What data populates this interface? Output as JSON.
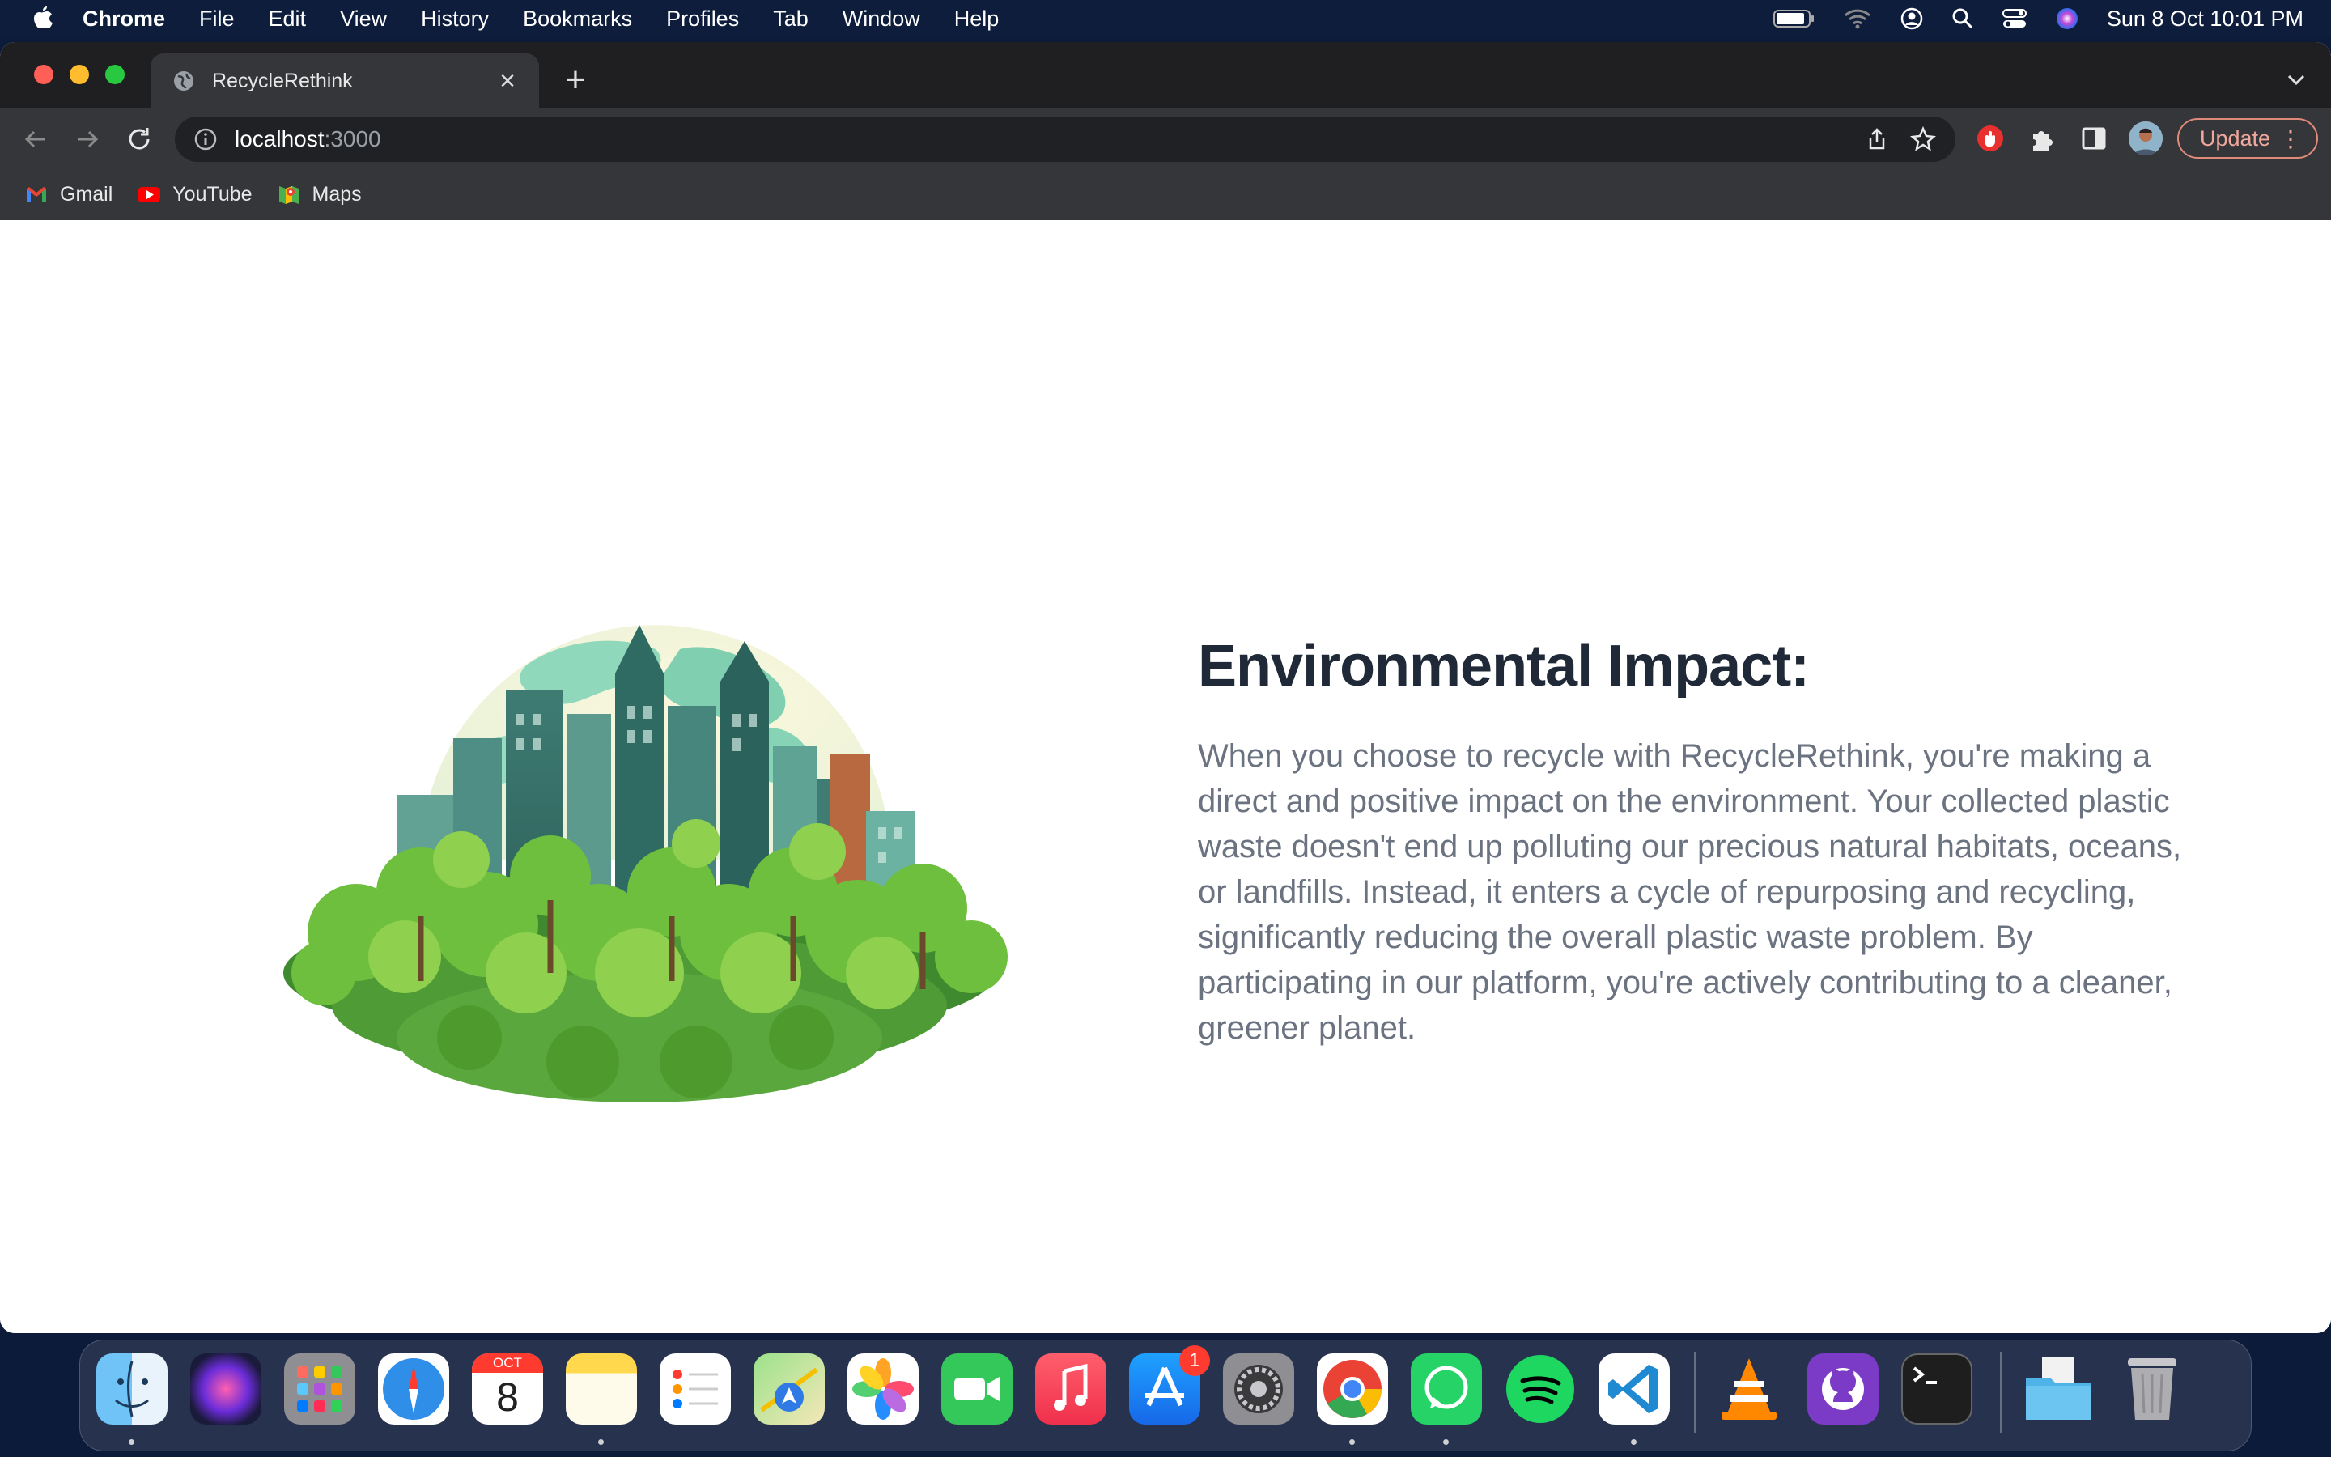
{
  "menubar": {
    "app": "Chrome",
    "items": [
      "File",
      "Edit",
      "View",
      "History",
      "Bookmarks",
      "Profiles",
      "Tab",
      "Window",
      "Help"
    ],
    "datetime": "Sun 8 Oct  10:01 PM"
  },
  "browser": {
    "tab_title": "RecycleRethink",
    "url_host": "localhost",
    "url_port": ":3000",
    "update_label": "Update",
    "bookmarks": [
      "Gmail",
      "YouTube",
      "Maps"
    ]
  },
  "page": {
    "heading": "Environmental Impact:",
    "paragraph": "When you choose to recycle with RecycleRethink, you're making a direct and positive impact on the environment. Your collected plastic waste doesn't end up polluting our precious natural habitats, oceans, or landfills. Instead, it enters a cycle of repurposing and recycling, significantly reducing the overall plastic waste problem. By participating in our platform, you're actively contributing to a cleaner, greener planet."
  },
  "dock": {
    "calendar_month": "OCT",
    "calendar_day": "8",
    "appstore_badge": "1",
    "apps": [
      "Finder",
      "Siri",
      "Launchpad",
      "Safari",
      "Calendar",
      "Notes",
      "Reminders",
      "Maps",
      "Photos",
      "FaceTime",
      "Music",
      "App Store",
      "System Settings",
      "Chrome",
      "WhatsApp",
      "Spotify",
      "VS Code",
      "VLC",
      "GitHub Desktop",
      "Terminal",
      "Downloads",
      "Trash"
    ]
  },
  "colors": {
    "heading": "#1f2937",
    "body_text": "#6b7280",
    "menubar_bg": "#0e1d3c",
    "chrome_toolbar": "#35363a"
  }
}
